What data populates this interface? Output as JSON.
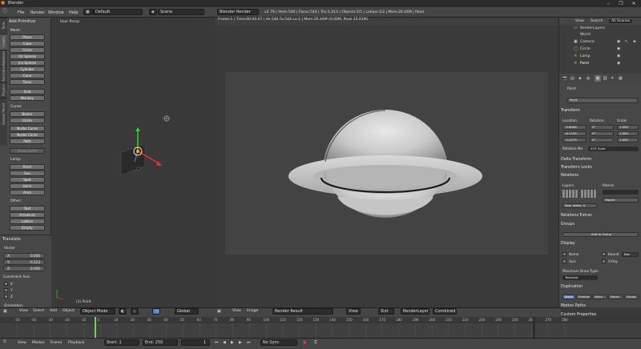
{
  "window": {
    "title": "Blender"
  },
  "menu": {
    "file": "File",
    "render": "Render",
    "window": "Window",
    "help": "Help",
    "layout": "Default",
    "scene": "Scene",
    "engine": "Blender Render",
    "stats": "v2.79 | Verts:546 | Faces:544 | Tris:1,014 | Objects:1/5 | Lamps:1/2 | Mem:26.44M | Point"
  },
  "toolshelf": {
    "tabs": [
      "Tools",
      "Create",
      "Relations",
      "Animation",
      "Physics",
      "Grease Pencil"
    ],
    "add_primitive": "Add Primitive",
    "mesh_label": "Mesh:",
    "mesh": [
      "Plane",
      "Cube",
      "Circle",
      "UV Sphere",
      "Ico Sphere",
      "Cylinder",
      "Cone",
      "Torus",
      "Grid",
      "Monkey"
    ],
    "curve_label": "Curve:",
    "curve": [
      "Bezier",
      "Circle",
      "Nurbs Curve",
      "Nurbs Circle",
      "Path"
    ],
    "draw_curve": "Draw Curve",
    "lamp_label": "Lamp:",
    "lamp": [
      "Point",
      "Sun",
      "Spot",
      "Hemi",
      "Area"
    ],
    "other_label": "Other:",
    "other": [
      "Text",
      "Armature",
      "Lattice",
      "Empty"
    ]
  },
  "translate": {
    "title": "Translate",
    "vector_label": "Vector",
    "x_label": "X:",
    "x": "0.000",
    "y_label": "Y:",
    "y": "-0.223",
    "z_label": "Z:",
    "z": "0.000",
    "constraint_label": "Constraint Axis",
    "axes": [
      "X",
      "Y",
      "Z"
    ],
    "orientation": "Orientation"
  },
  "viewport": {
    "label": "User Persp",
    "object_label": "(1) Point"
  },
  "render_view": {
    "info": "Frame:1 | Time:00:00.67 | Ve:546 Fa:544 La:2 | Mem:26.44M (0.00M, Peak 33.01M)"
  },
  "outliner": {
    "tabs": [
      "View",
      "Search",
      "All Scenes"
    ],
    "items": [
      "RenderLayers",
      "World",
      "Camera",
      "Circle",
      "Lamp",
      "Point"
    ]
  },
  "properties": {
    "object_name": "Point",
    "transform": "Transform",
    "location_label": "Location:",
    "rotation_label": "Rotation:",
    "scale_label": "Scale:",
    "location": [
      "-5.6808",
      "-6.1793",
      "-5.4379"
    ],
    "rotation": [
      "0°",
      "0°",
      "0°"
    ],
    "scale": [
      "1.000",
      "1.000",
      "1.000"
    ],
    "rotation_mode_label": "Rotation Mo",
    "rotation_mode": "XYZ Euler",
    "delta_transform": "Delta Transform",
    "transform_locks": "Transform Locks",
    "relations": "Relations",
    "layers_label": "Layers:",
    "parent_label": "Parent:",
    "parent_type": "Object",
    "pass_index": "Pass Index:",
    "pass_index_value": "0",
    "relations_extras": "Relations Extras",
    "groups": "Groups",
    "add_to_group": "Add to Group",
    "display": "Display",
    "name": "Name",
    "bounds": "Bound",
    "bounds_type": "Box",
    "axis": "Axis",
    "xray": "X-Ray",
    "max_draw_type": "Maximum Draw Type:",
    "max_draw_value": "Textured",
    "duplication": "Duplication",
    "dup_tabs": [
      "None",
      "Frames",
      "Verts",
      "Faces",
      "Group"
    ],
    "motion_paths": "Motion Paths",
    "custom_props": "Custom Properties"
  },
  "viewport_header": {
    "view": "View",
    "select": "Select",
    "add": "Add",
    "object": "Object",
    "mode": "Object Mode",
    "orientation": "Global"
  },
  "render_header": {
    "view": "View",
    "image": "Image",
    "name": "Render Result",
    "view2": "View",
    "slot": "Slot",
    "layer": "RenderLayer",
    "pass": "Combined"
  },
  "timeline": {
    "ticks": [
      "-50",
      "-40",
      "-30",
      "-20",
      "-10",
      "0",
      "10",
      "20",
      "30",
      "40",
      "50",
      "60",
      "70",
      "80",
      "90",
      "100",
      "110",
      "120",
      "130",
      "140",
      "150",
      "160",
      "170",
      "180",
      "190",
      "200",
      "210",
      "220",
      "230",
      "240",
      "250",
      "260",
      "270",
      "280"
    ]
  },
  "footer": {
    "view": "View",
    "marker": "Marker",
    "frame": "Frame",
    "playback": "Playback",
    "start_label": "Start:",
    "start": "1",
    "end_label": "End:",
    "end": "250",
    "current": "1",
    "sync": "No Sync"
  }
}
